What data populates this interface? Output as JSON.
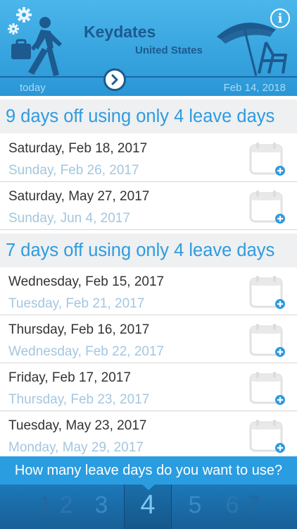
{
  "header": {
    "title": "Keydates",
    "country": "United States",
    "today_label": "today",
    "current_date": "Feb 14, 2018",
    "icons": [
      "settings-gears-icon",
      "walking-man-icon",
      "beach-umbrella-icon",
      "beach-chair-icon",
      "chevron-right-icon",
      "info-icon"
    ],
    "info_label": "i"
  },
  "sections": [
    {
      "title": "9 days off using only 4 leave days",
      "rows": [
        {
          "start": "Saturday, Feb 18, 2017",
          "end": "Sunday, Feb 26, 2017"
        },
        {
          "start": "Saturday, May 27, 2017",
          "end": "Sunday, Jun 4, 2017"
        }
      ]
    },
    {
      "title": "7 days off using only 4 leave days",
      "rows": [
        {
          "start": "Wednesday, Feb 15, 2017",
          "end": "Tuesday, Feb 21, 2017"
        },
        {
          "start": "Thursday, Feb 16, 2017",
          "end": "Wednesday, Feb 22, 2017"
        },
        {
          "start": "Friday, Feb 17, 2017",
          "end": "Thursday, Feb 23, 2017"
        },
        {
          "start": "Tuesday, May 23, 2017",
          "end": "Monday, May 29, 2017"
        }
      ]
    }
  ],
  "bottom": {
    "question": "How many leave days do you want to use?",
    "picker": [
      "1",
      "2",
      "3",
      "4",
      "5",
      "6",
      "7"
    ],
    "selected": "4"
  },
  "colors": {
    "accent": "#2f9be0",
    "header_dark": "#1c5a8f",
    "end_date": "#a3c7df",
    "picker_bg": "#185f97"
  }
}
